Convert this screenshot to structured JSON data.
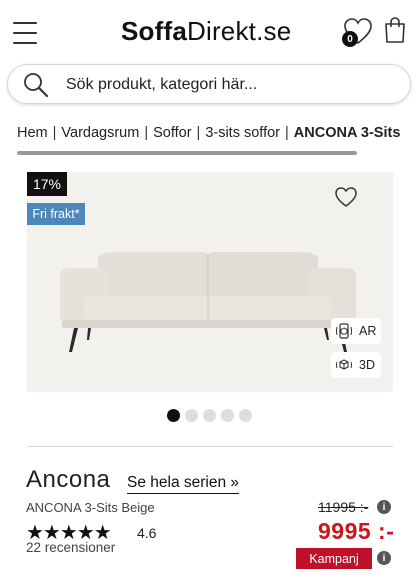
{
  "header": {
    "logo_bold": "Soffa",
    "logo_regular": "Direkt.se",
    "wishlist_count": "0",
    "icons": [
      "menu-icon",
      "heart-icon",
      "shopping-bag-icon"
    ]
  },
  "search": {
    "placeholder": "Sök produkt, kategori här..."
  },
  "breadcrumb": {
    "items": [
      "Hem",
      "Vardagsrum",
      "Soffor",
      "3-sits soffor"
    ],
    "current": "ANCONA 3-Sits"
  },
  "gallery": {
    "discount_badge": "17%",
    "shipping_badge": "Fri frakt*",
    "ar_label": "AR",
    "view3d_label": "3D",
    "image_count": 5,
    "active_image": 1,
    "colors": {
      "discount_bg": "#111111",
      "shipping_bg": "#4d86b8",
      "image_bg": "#f3f1ee"
    }
  },
  "product": {
    "name": "Ancona",
    "series_link": "Se hela serien »",
    "variant": "ANCONA 3-Sits Beige",
    "rating_value": "4.6",
    "stars": "★★★★★",
    "reviews": "22 recensioner",
    "old_price": "11995 :-",
    "price": "9995 :-",
    "campaign_label": "Kampanj",
    "info_icon": "i",
    "colors": {
      "price": "#d0121b",
      "campaign_bg": "#c0102a"
    }
  }
}
